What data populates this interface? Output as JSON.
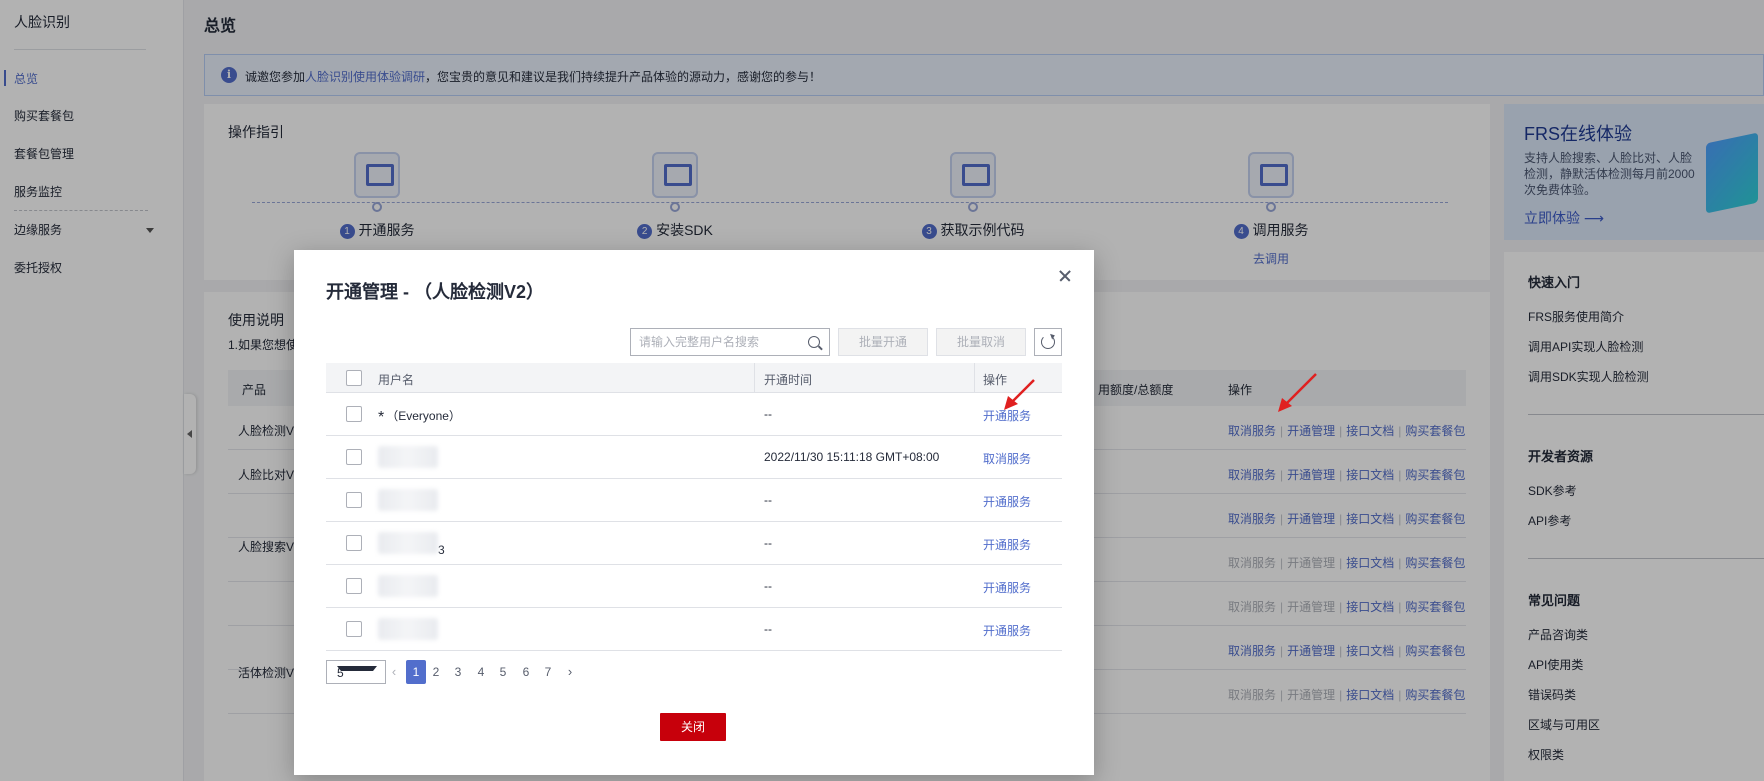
{
  "sidebar": {
    "title": "人脸识别",
    "items": [
      {
        "label": "总览",
        "active": true
      },
      {
        "label": "购买套餐包"
      },
      {
        "label": "套餐包管理"
      },
      {
        "label": "服务监控"
      },
      {
        "label": "边缘服务"
      },
      {
        "label": "委托授权"
      }
    ]
  },
  "page": {
    "title": "总览",
    "notice": {
      "prefix": "诚邀您参加",
      "link": "人脸识别使用体验调研",
      "suffix": "，您宝贵的意见和建议是我们持续提升产品体验的源动力，感谢您的参与！"
    }
  },
  "guide": {
    "title": "操作指引",
    "steps": [
      {
        "num": "1",
        "label": "开通服务",
        "link": ""
      },
      {
        "num": "2",
        "label": "安装SDK",
        "link": ""
      },
      {
        "num": "3",
        "label": "获取示例代码",
        "link": ""
      },
      {
        "num": "4",
        "label": "调用服务",
        "link": "去调用"
      }
    ]
  },
  "usage": {
    "title": "使用说明",
    "desc": "1.如果您想使",
    "col_product": "产品",
    "col_quota": "用额度/总额度",
    "col_ops": "操作",
    "products": [
      "人脸检测V",
      "人脸比对V",
      "人脸搜索V",
      "活体检测V"
    ],
    "ops": {
      "cancel": "取消服务",
      "manage": "开通管理",
      "doc": "接口文档",
      "buy": "购买套餐包"
    }
  },
  "frs": {
    "title": "FRS在线体验",
    "desc": "支持人脸搜索、人脸比对、人脸检测，静默活体检测每月前2000次免费体验。",
    "link": "立即体验"
  },
  "quick": {
    "sections": [
      {
        "title": "快速入门",
        "items": [
          "FRS服务使用简介",
          "调用API实现人脸检测",
          "调用SDK实现人脸检测"
        ]
      },
      {
        "title": "开发者资源",
        "items": [
          "SDK参考",
          "API参考"
        ]
      },
      {
        "title": "常见问题",
        "items": [
          "产品咨询类",
          "API使用类",
          "错误码类",
          "区域与可用区",
          "权限类"
        ]
      }
    ]
  },
  "modal": {
    "title": "开通管理 - （人脸检测V2）",
    "search_placeholder": "请输入完整用户名搜索",
    "batch_enable": "批量开通",
    "batch_cancel": "批量取消",
    "columns": {
      "user": "用户名",
      "time": "开通时间",
      "op": "操作"
    },
    "rows": [
      {
        "user": "（Everyone）",
        "star": "*",
        "time": "--",
        "op": "开通服务"
      },
      {
        "user": "",
        "time": "2022/11/30 15:11:18 GMT+08:00",
        "op": "取消服务"
      },
      {
        "user": "",
        "time": "--",
        "op": "开通服务"
      },
      {
        "user": "3",
        "time": "--",
        "op": "开通服务"
      },
      {
        "user": "",
        "time": "--",
        "op": "开通服务"
      },
      {
        "user": "",
        "time": "--",
        "op": "开通服务"
      }
    ],
    "pager": {
      "size": "5",
      "pages": [
        "1",
        "2",
        "3",
        "4",
        "5",
        "6",
        "7"
      ],
      "current": "1"
    },
    "close": "关闭"
  },
  "colors": {
    "accent": "#526ecc",
    "danger": "#c7000b",
    "arrow": "#e02020"
  }
}
